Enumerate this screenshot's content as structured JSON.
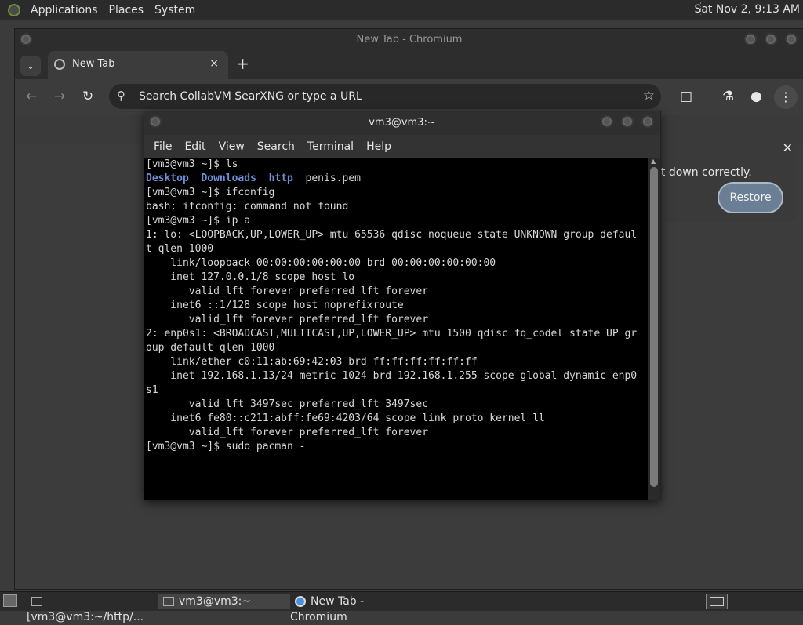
{
  "top_panel": {
    "menus": [
      "Applications",
      "Places",
      "System"
    ],
    "clock": "Sat Nov 2, 9:13 AM"
  },
  "chromium": {
    "window_title": "New Tab - Chromium",
    "tab_label": "New Tab",
    "tab_close": "×",
    "new_tab": "+",
    "omnibox_placeholder": "Search CollabVM SearXNG or type a URL",
    "restore_message": "ıt down correctly.",
    "restore_button": "Restore"
  },
  "terminal": {
    "title": "vm3@vm3:~",
    "menu": [
      "File",
      "Edit",
      "View",
      "Search",
      "Terminal",
      "Help"
    ],
    "lines": [
      "[vm3@vm3 ~]$ ls",
      "__LS__",
      "[vm3@vm3 ~]$ ifconfig",
      "bash: ifconfig: command not found",
      "[vm3@vm3 ~]$ ip a",
      "1: lo: <LOOPBACK,UP,LOWER_UP> mtu 65536 qdisc noqueue state UNKNOWN group defaul",
      "t qlen 1000",
      "    link/loopback 00:00:00:00:00:00 brd 00:00:00:00:00:00",
      "    inet 127.0.0.1/8 scope host lo",
      "       valid_lft forever preferred_lft forever",
      "    inet6 ::1/128 scope host noprefixroute",
      "       valid_lft forever preferred_lft forever",
      "2: enp0s1: <BROADCAST,MULTICAST,UP,LOWER_UP> mtu 1500 qdisc fq_codel state UP gr",
      "oup default qlen 1000",
      "    link/ether c0:11:ab:69:42:03 brd ff:ff:ff:ff:ff:ff",
      "    inet 192.168.1.13/24 metric 1024 brd 192.168.1.255 scope global dynamic enp0",
      "s1",
      "       valid_lft 3497sec preferred_lft 3497sec",
      "    inet6 fe80::c211:abff:fe69:4203/64 scope link proto kernel_ll",
      "       valid_lft forever preferred_lft forever",
      "[vm3@vm3 ~]$ sudo pacman -"
    ],
    "ls_dirs": [
      "Desktop",
      "Downloads",
      "http"
    ],
    "ls_file": "penis.pem"
  },
  "taskbar": {
    "tasks": [
      "[vm3@vm3:~/http/...",
      "vm3@vm3:~",
      "New Tab - Chromium"
    ]
  },
  "colors": {
    "dir_blue": "#6f8fd8",
    "restore_button": "#6a7f95"
  }
}
